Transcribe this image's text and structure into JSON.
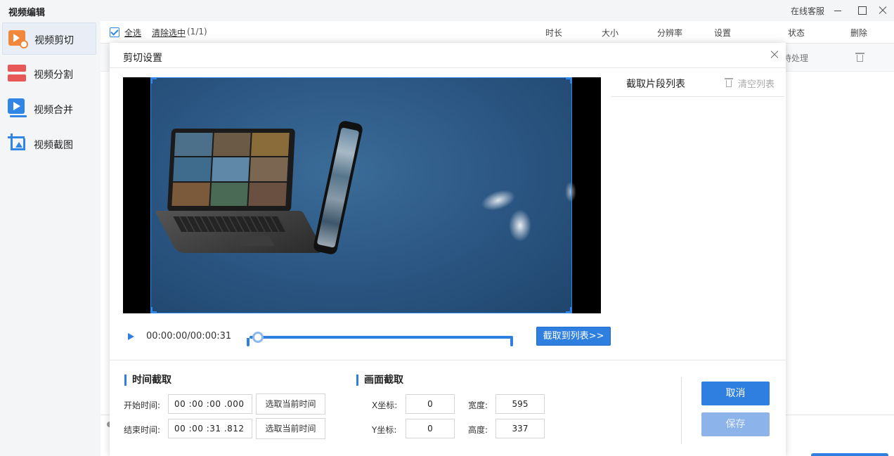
{
  "window": {
    "title": "视频编辑",
    "support_label": "在线客服"
  },
  "sidebar": {
    "items": [
      {
        "label": "视频剪切",
        "icon": "video-cut-icon",
        "active": true
      },
      {
        "label": "视频分割",
        "icon": "video-split-icon",
        "active": false
      },
      {
        "label": "视频合并",
        "icon": "video-merge-icon",
        "active": false
      },
      {
        "label": "视频截图",
        "icon": "video-screenshot-icon",
        "active": false
      }
    ]
  },
  "list": {
    "select_all": "全选",
    "clear_selection": "清除选中",
    "selection_count": "(1/1)",
    "columns": [
      "时长",
      "大小",
      "分辨率",
      "设置",
      "状态",
      "删除"
    ],
    "row_status": "待处理"
  },
  "dialog": {
    "title": "剪切设置",
    "player": {
      "timecode": "00:00:00/00:00:31",
      "progress": 0.0
    },
    "add_to_list_label": "截取到列表>>",
    "clip_list": {
      "title": "截取片段列表",
      "clear_label": "清空列表"
    },
    "time_section": {
      "title": "时间截取",
      "start_label": "开始时间:",
      "start_value": "00 :00 :00 .000",
      "end_label": "结束时间:",
      "end_value": "00 :00 :31 .812",
      "pick_current_label": "选取当前时间"
    },
    "crop_section": {
      "title": "画面截取",
      "x_label": "X坐标:",
      "x_value": "0",
      "y_label": "Y坐标:",
      "y_value": "0",
      "width_label": "宽度:",
      "width_value": "595",
      "height_label": "高度:",
      "height_value": "337"
    },
    "cancel_label": "取消",
    "save_label": "保存"
  },
  "colors": {
    "accent": "#2f7fe0",
    "accent_disabled": "#8db4ea"
  }
}
